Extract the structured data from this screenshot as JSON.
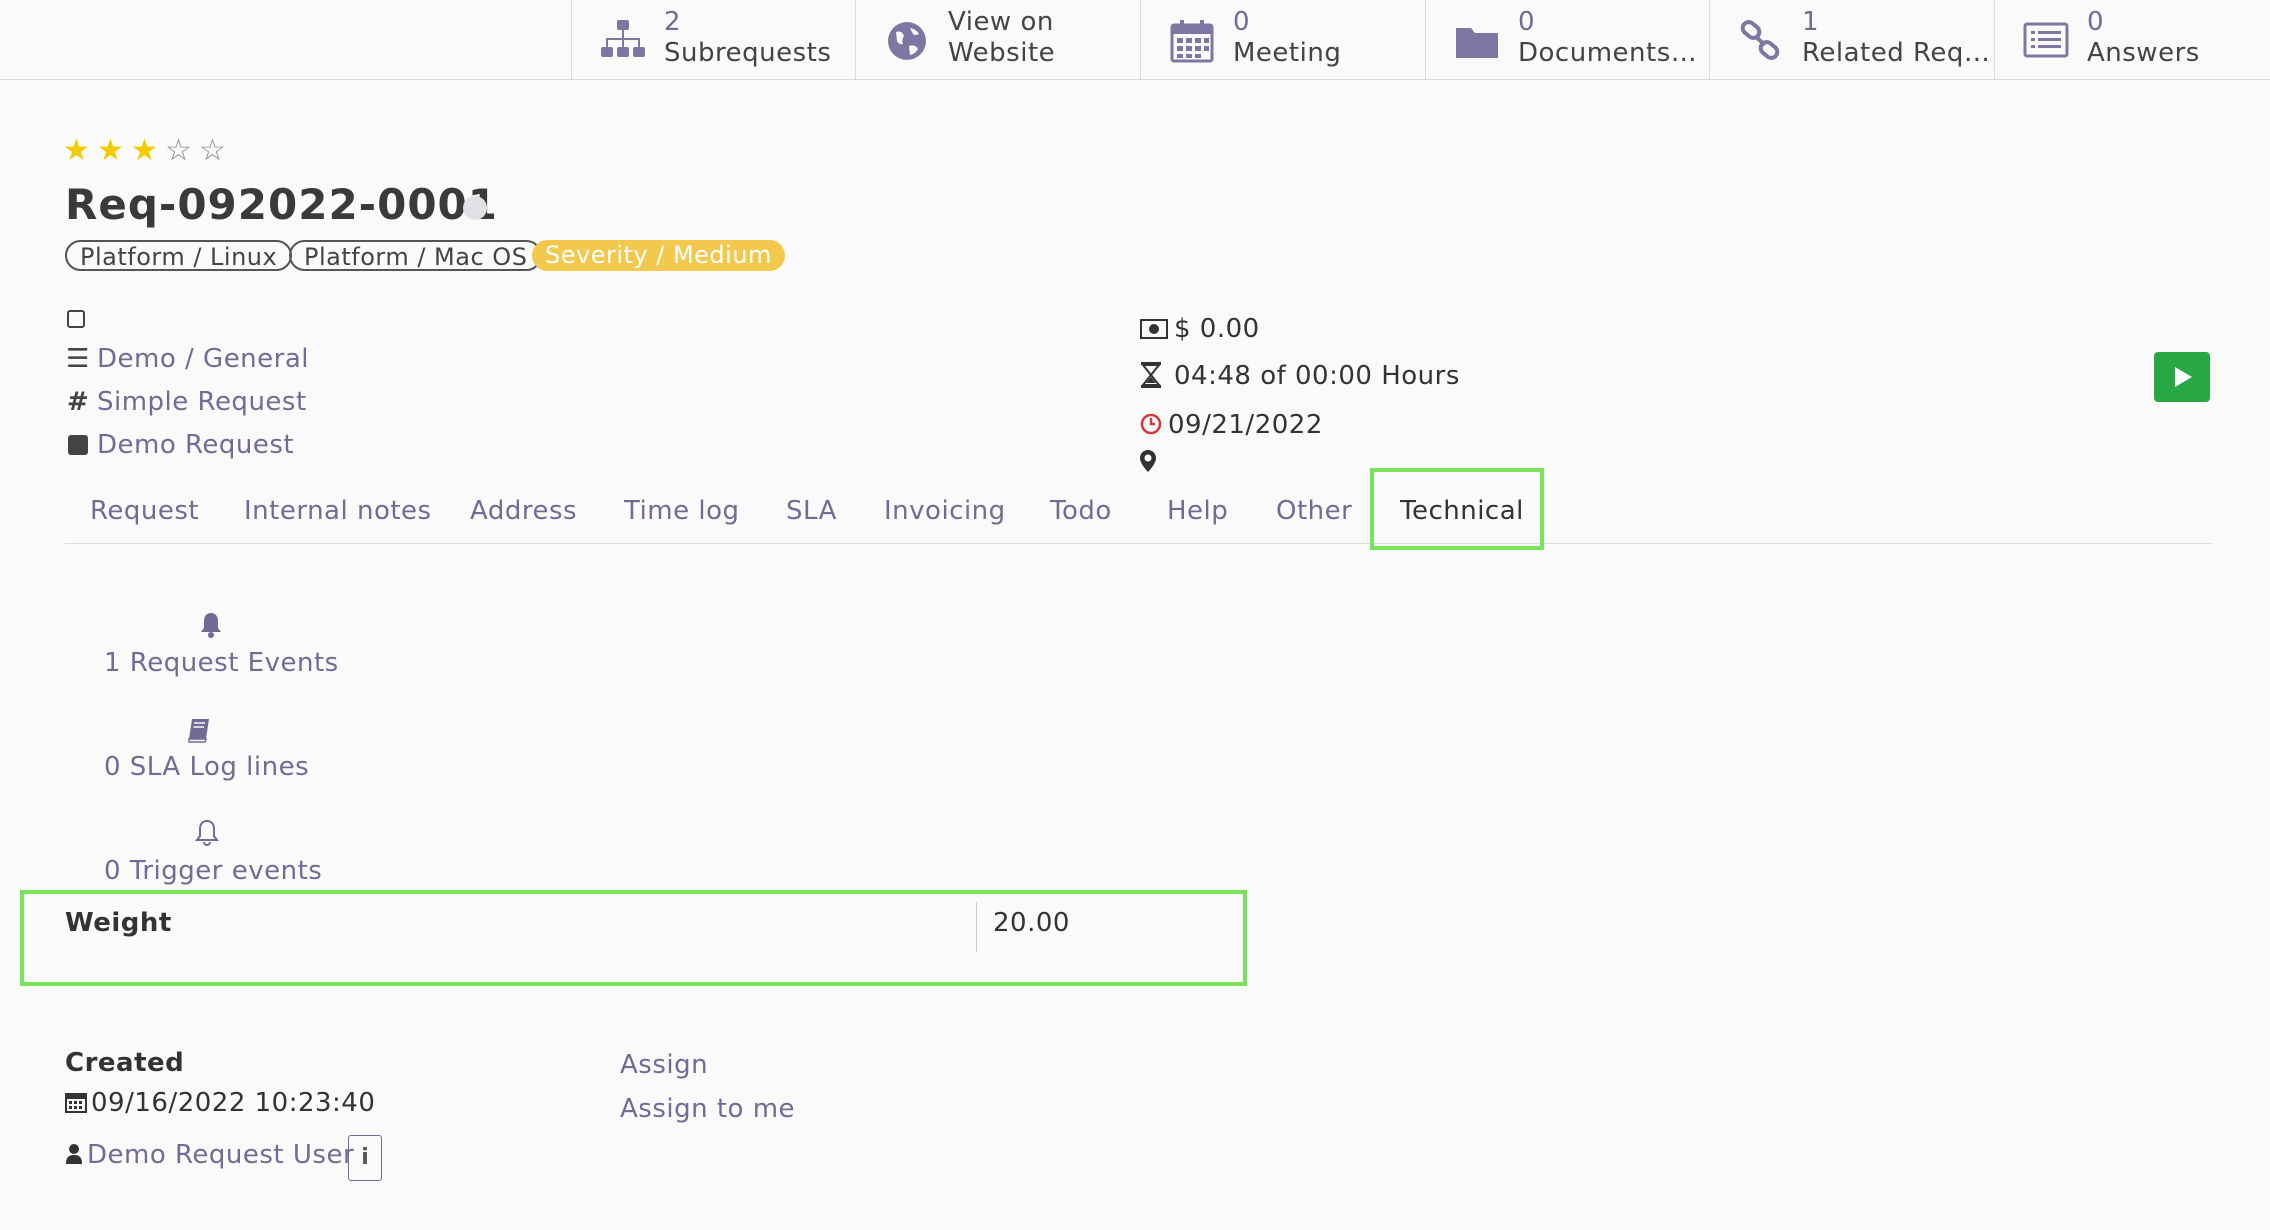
{
  "smart_buttons": [
    {
      "icon": "sitemap-icon",
      "count": "2",
      "label": "Subrequests"
    },
    {
      "icon": "globe-icon",
      "line1": "View on",
      "line2": "Website"
    },
    {
      "icon": "calendar-icon",
      "count": "0",
      "label": "Meeting"
    },
    {
      "icon": "folder-icon",
      "count": "0",
      "label": "Documents…"
    },
    {
      "icon": "link-icon",
      "count": "1",
      "label": "Related Req…"
    },
    {
      "icon": "list-icon",
      "count": "0",
      "label": "Answers"
    }
  ],
  "rating": {
    "filled": 3,
    "total": 5
  },
  "request": {
    "name": "Req-092022-0001",
    "tags": [
      "Platform / Linux",
      "Platform / Mac OS",
      "Severity / Medium"
    ],
    "category": "Demo / General",
    "type": "Simple Request",
    "kind": "Demo Request"
  },
  "summary": {
    "amount": "$ 0.00",
    "time": "04:48 of 00:00 Hours",
    "deadline": "09/21/2022"
  },
  "tabs": [
    "Request",
    "Internal notes",
    "Address",
    "Time log",
    "SLA",
    "Invoicing",
    "Todo",
    "Help",
    "Other",
    "Technical"
  ],
  "active_tab": "Technical",
  "technical": {
    "events": "1 Request Events",
    "sla_log": "0 SLA Log lines",
    "triggers": "0 Trigger events",
    "weight_label": "Weight",
    "weight_value": "20.00"
  },
  "created": {
    "label": "Created",
    "date": "09/16/2022 10:23:40",
    "user": "Demo Request User",
    "info_icon": "i"
  },
  "actions": {
    "assign": "Assign",
    "assign_to_me": "Assign to me"
  },
  "colors": {
    "accent": "#716b96",
    "star": "#f3cc00",
    "tag_yellow": "#f2c94c",
    "highlight": "#7be35a",
    "run": "#28a745"
  }
}
